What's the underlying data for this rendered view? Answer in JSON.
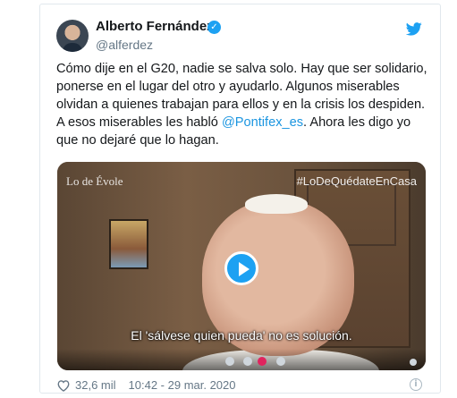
{
  "author": {
    "name": "Alberto Fernández",
    "handle": "@alferdez",
    "verified_icon": "verified-check-icon",
    "avatar": "avatar"
  },
  "tweet": {
    "text_before": "Cómo dije en el G20, nadie se salva solo. Hay que ser solidario,\nponerse en el lugar del otro y ayudarlo. Algunos miserables\nolvidan a quienes trabajan para ellos y en la crisis los despiden.\nA esos miserables les habló ",
    "mention": "@Pontifex_es",
    "text_after": ". Ahora les digo yo\nque no dejaré que lo hagan."
  },
  "media": {
    "watermark_left": "Lo de Évole",
    "watermark_right": "#LoDeQuédateEnCasa",
    "subtitle": "El 'sálvese quien pueda' no es solución.",
    "play_icon": "play-icon"
  },
  "footer": {
    "likes": "32,6 mil",
    "timestamp": "10:42 - 29 mar. 2020",
    "heart_icon": "heart-icon",
    "info_icon": "info-icon"
  },
  "colors": {
    "accent": "#1da1f2",
    "mention": "#1b95e0",
    "secondary_text": "#657786"
  }
}
